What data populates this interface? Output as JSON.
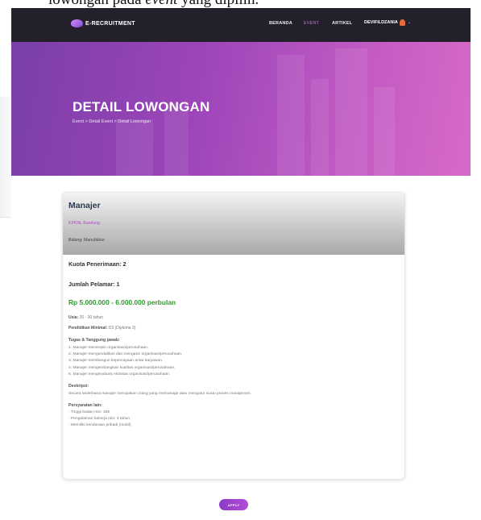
{
  "document_fragment": {
    "prefix": "lowongan pada ",
    "em": "event",
    "suffix": " yang dipilih."
  },
  "navbar": {
    "brand": "E-RECRUITMENT",
    "items": [
      {
        "label": "BERANDA",
        "active": false
      },
      {
        "label": "EVENT",
        "active": true
      },
      {
        "label": "ARTIKEL",
        "active": false
      }
    ],
    "user": "DEVIFILDZANIA"
  },
  "hero": {
    "title": "DETAIL LOWONGAN",
    "breadcrumb": "Event > Detail Event > Detail Lowongan"
  },
  "job": {
    "title": "Manajer",
    "company": "KPKNL Bandung",
    "field": "Bidang: Manufaktur",
    "quota": "Kuota Penerimaan: 2",
    "applicants": "Jumlah Pelamar: 1",
    "salary": "Rp 5.000.000 - 6.000.000 perbulan",
    "age_label": "Usia:",
    "age_value": " 20 - 30 tahun",
    "education_label": "Pendidikan Minimal:",
    "education_value": " D3 (Diploma 3)",
    "duties_heading": "Tugas & Tanggung jawab:",
    "duties": [
      "1. Manajer memimpin organisasi/perusahaan.",
      "2. Manajer mengendalikan dan mengatur organisasi/perusahaan.",
      "3. Manajer membangun kepercayaan antar karyawan.",
      "4. Manajer mengembangkan kualitas organisasi/perusahaan.",
      "5. Manajer mengevaluasi Aktivitas organisasi/perusahaan."
    ],
    "description_heading": "Deskripsi:",
    "description": "Secara sederhana manajer merupakan orang yang memanage atau mengatur suatu proses manajemen.",
    "requirements_heading": "Persyaratan lain:",
    "requirements": [
      "- Tinggi badan min: 165",
      "- Pengalaman bekerja min: 3 tahun",
      "- Memiliki kendaraan pribadi (mobil)"
    ]
  },
  "actions": {
    "apply_label": "APPLY"
  },
  "colors": {
    "navbar": "#23202b",
    "accent": "#b54cd6",
    "salary": "#2f9a2f"
  }
}
